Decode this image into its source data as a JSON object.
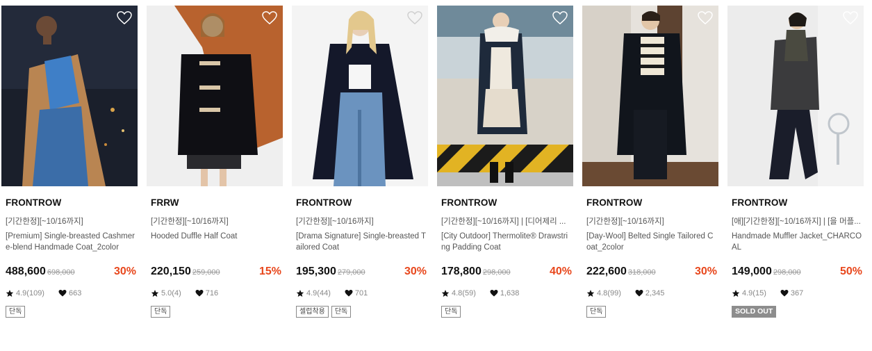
{
  "icons": {
    "wishlist": "heart-outline-icon",
    "rating": "star-icon",
    "likes": "heart-filled-icon"
  },
  "colors": {
    "discount": "#e8471c",
    "soldout_bg": "#8d8d8d"
  },
  "products": [
    {
      "brand": "FRONTROW",
      "promo": "[기간한정][~10/16까지]",
      "name": "[Premium] Single-breasted Cashmere-blend Handmade Coat_2color",
      "price": "488,600",
      "original_price": "698,000",
      "discount": "30%",
      "rating": "4.9(109)",
      "likes": "663",
      "tags": [
        "단독"
      ]
    },
    {
      "brand": "FRRW",
      "promo": "[기간한정][~10/16까지]",
      "name": "Hooded Duffle Half Coat",
      "price": "220,150",
      "original_price": "259,000",
      "discount": "15%",
      "rating": "5.0(4)",
      "likes": "716",
      "tags": [
        "단독"
      ]
    },
    {
      "brand": "FRONTROW",
      "promo": "[기간한정][~10/16까지]",
      "name": "[Drama Signature] Single-breasted Tailored Coat",
      "price": "195,300",
      "original_price": "279,000",
      "discount": "30%",
      "rating": "4.9(44)",
      "likes": "701",
      "tags": [
        "셀럽착용",
        "단독"
      ]
    },
    {
      "brand": "FRONTROW",
      "promo": "[기간한정][~10/16까지] | [디어제리 ...",
      "name": "[City Outdoor] Thermolite® Drawstring Padding Coat",
      "price": "178,800",
      "original_price": "298,000",
      "discount": "40%",
      "rating": "4.8(59)",
      "likes": "1,638",
      "tags": [
        "단독"
      ]
    },
    {
      "brand": "FRONTROW",
      "promo": "[기간한정][~10/16까지]",
      "name": "[Day-Wool] Belted Single Tailored Coat_2color",
      "price": "222,600",
      "original_price": "318,000",
      "discount": "30%",
      "rating": "4.8(99)",
      "likes": "2,345",
      "tags": [
        "단독"
      ]
    },
    {
      "brand": "FRONTROW",
      "promo": "[애][기간한정][~10/16까지] | [을 머플...",
      "name": "Handmade Muffler Jacket_CHARCOAL",
      "price": "149,000",
      "original_price": "298,000",
      "discount": "50%",
      "rating": "4.9(15)",
      "likes": "367",
      "soldout": "SOLD OUT"
    }
  ]
}
